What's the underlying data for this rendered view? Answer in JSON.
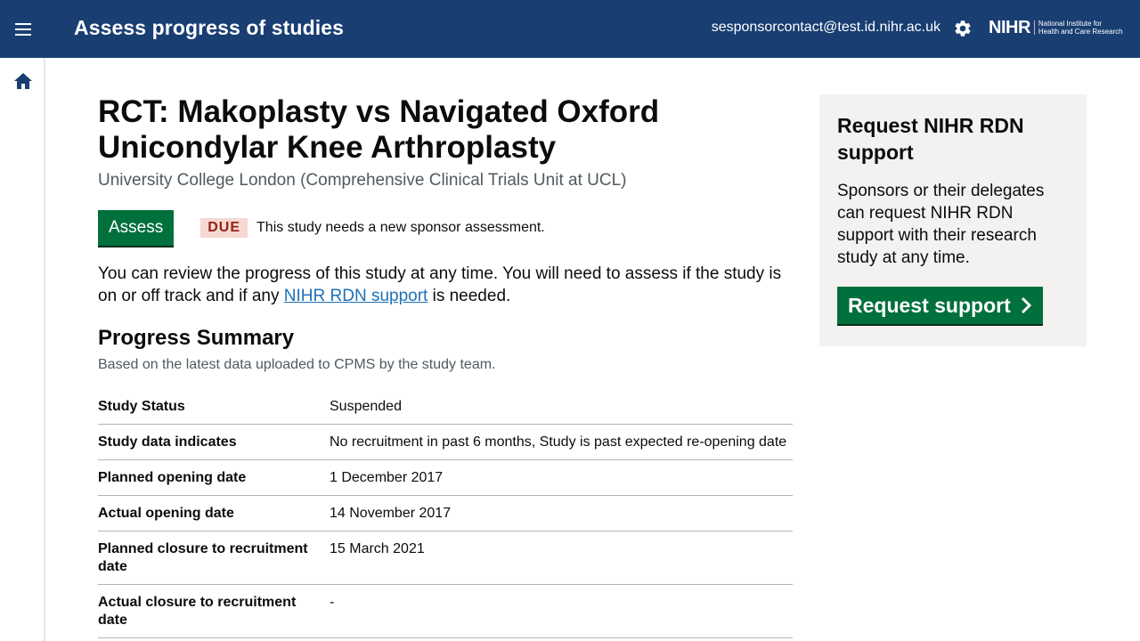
{
  "header": {
    "app_title": "Assess progress of studies",
    "user_email": "sesponsorcontact@test.id.nihr.ac.uk",
    "logo_main": "NIHR",
    "logo_sub_line1": "National Institute for",
    "logo_sub_line2": "Health and Care Research",
    "menu_icon": "hamburger-menu-icon",
    "settings_icon": "gear-icon"
  },
  "sidenav": {
    "home_icon": "home-icon"
  },
  "study": {
    "title": "RCT: Makoplasty vs Navigated Oxford Unicondylar Knee Arthroplasty",
    "organisation": "University College London (Comprehensive Clinical Trials Unit at UCL)",
    "assess_label": "Assess",
    "status_tag": "DUE",
    "status_text": "This study needs a new sponsor assessment.",
    "intro_before": "You can review the progress of this study at any time. You will need to assess if the study is on or off track and if any ",
    "intro_link": "NIHR RDN support",
    "intro_after": " is needed."
  },
  "progress_summary": {
    "title": "Progress Summary",
    "hint": "Based on the latest data uploaded to CPMS by the study team.",
    "rows": [
      {
        "key": "Study Status",
        "value": "Suspended"
      },
      {
        "key": "Study data indicates",
        "value": "No recruitment in past 6 months, Study is past expected re-opening date"
      },
      {
        "key": "Planned opening date",
        "value": "1 December 2017"
      },
      {
        "key": "Actual opening date",
        "value": "14 November 2017"
      },
      {
        "key": "Planned closure to recruitment date",
        "value": "15 March 2021"
      },
      {
        "key": "Actual closure to recruitment date",
        "value": "-"
      }
    ]
  },
  "support_card": {
    "title": "Request NIHR RDN support",
    "body": "Sponsors or their delegates can request NIHR RDN support with their research study at any time.",
    "button_label": "Request support",
    "button_icon": "chevron-right-icon"
  },
  "colors": {
    "header_bg": "#193e72",
    "primary_button": "#00703c",
    "link": "#1d70b8",
    "due_tag_bg": "#f6d7d2",
    "due_tag_text": "#942514",
    "card_bg": "#f3f2f1"
  }
}
